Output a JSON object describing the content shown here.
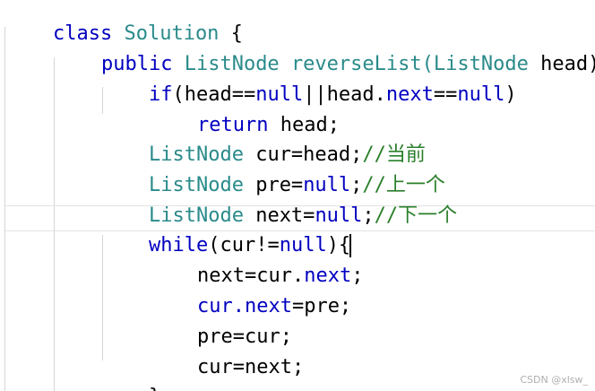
{
  "code": {
    "line1": {
      "t0": "class",
      "t1": " ",
      "t2": "Solution",
      "t3": " {"
    },
    "line2": {
      "t0": "public",
      "t1": " ",
      "t2": "ListNode",
      "t3": " ",
      "t4": "reverseList",
      "t5": "(",
      "t6": "ListNode",
      "t7": " head) {"
    },
    "line3": {
      "t0": "if",
      "t1": "(head==",
      "t2": "null",
      "t3": "||head.",
      "t4": "next",
      "t5": "==",
      "t6": "null",
      "t7": ")"
    },
    "line4": {
      "t0": "return",
      "t1": " head;"
    },
    "line5": {
      "t0": "ListNode",
      "t1": " cur=head;",
      "t2": "//当前"
    },
    "line6": {
      "t0": "ListNode",
      "t1": " pre=",
      "t2": "null",
      "t3": ";",
      "t4": "//上一个"
    },
    "line7": {
      "t0": "ListNode",
      "t1": " next=",
      "t2": "null",
      "t3": ";",
      "t4": "//下一个"
    },
    "line8": {
      "t0": "while",
      "t1": "(cur!=",
      "t2": "null",
      "t3": "){"
    },
    "line9": {
      "t0": "next=cur.",
      "t1": "next",
      "t2": ";"
    },
    "line10": {
      "t0": "cur.",
      "t1": "next",
      "t2": "=pre;"
    },
    "line11": {
      "t0": "pre=cur;"
    },
    "line12": {
      "t0": "cur=next;"
    },
    "line13": {
      "t0": "}"
    }
  },
  "watermark": "CSDN @xlsw_",
  "colors": {
    "keyword": "#0000c0",
    "type": "#2a8a8a",
    "comment": "#2a7f2a",
    "background": "#ffffff"
  }
}
